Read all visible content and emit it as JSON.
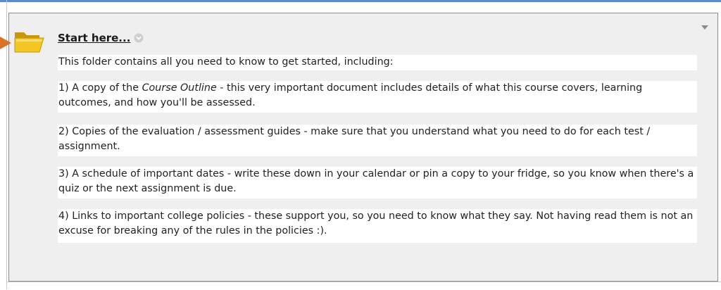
{
  "item": {
    "title": "Start here...",
    "paragraphs": [
      {
        "text": "This folder contains all you need to know to get started, including:"
      },
      {
        "before": "1) A copy of the ",
        "emphasis": "Course Outline",
        "after": " - this very important document includes details of what this course covers, learning outcomes, and how you'll be assessed."
      },
      {
        "text": "2) Copies of the evaluation / assessment guides - make sure that you understand what you need to do for each test / assignment."
      },
      {
        "text": "3) A schedule of important dates - write these down in your calendar or pin a copy to your fridge, so you know when there's a quiz or the next assignment is due."
      },
      {
        "text": "4) Links to important college policies - these support you, so you need to know what they say. Not having read them is not an excuse for breaking any of the rules in the policies :)."
      }
    ]
  },
  "icons": {
    "folder": "folder-icon",
    "options": "options-chevron-icon",
    "collapse": "collapse-triangle-icon",
    "pointer": "pointer-arrow-icon"
  },
  "colors": {
    "accent_border": "#5b8ad0",
    "pointer_arrow": "#d9732a",
    "folder": "#f3c623",
    "panel_bg": "#efefef"
  }
}
